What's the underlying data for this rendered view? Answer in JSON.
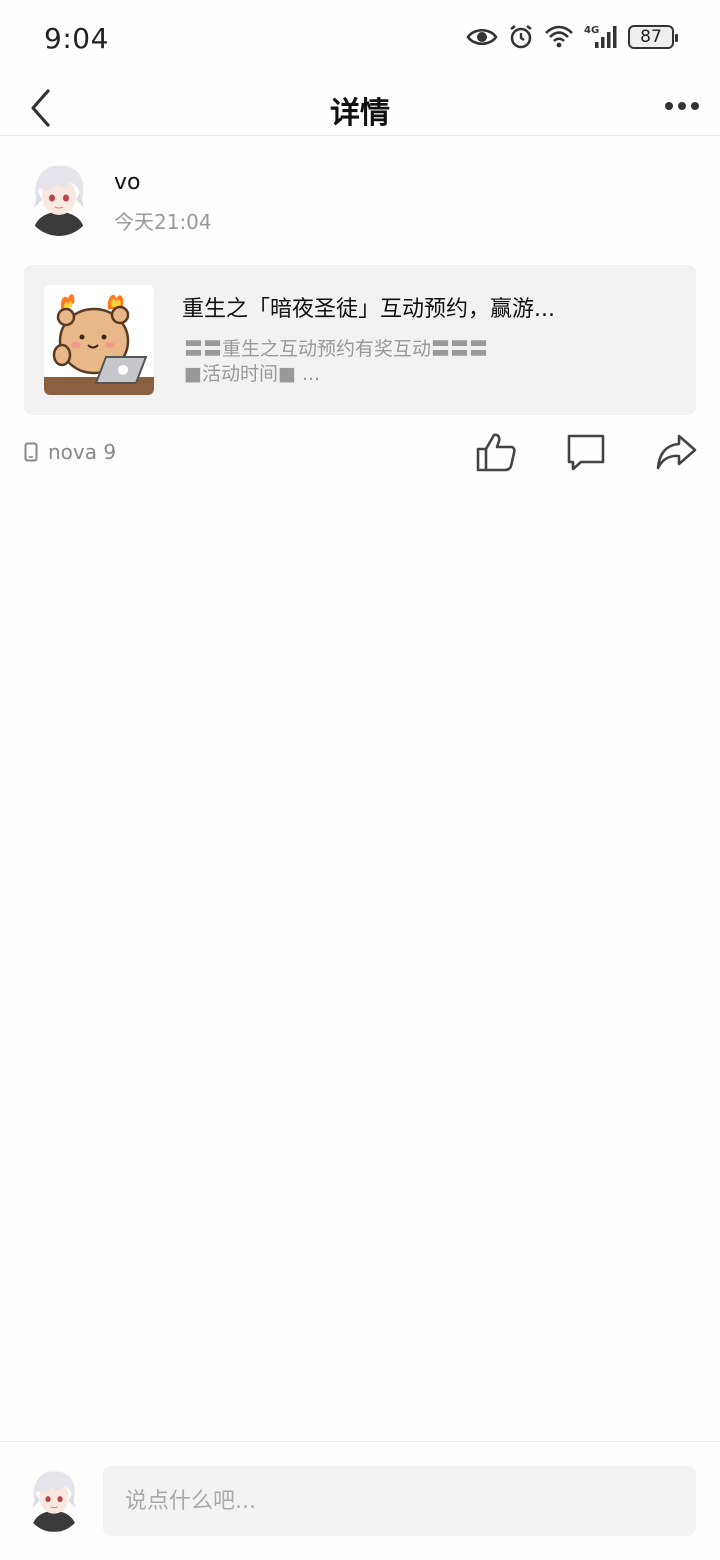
{
  "status_bar": {
    "time": "9:04",
    "battery": "87",
    "network": "4G",
    "icons": [
      "eye-icon",
      "alarm-icon",
      "wifi-icon",
      "signal-icon",
      "battery-icon"
    ]
  },
  "header": {
    "title": "详情",
    "back_icon": "back-arrow-icon",
    "more_icon": "more-dots-icon"
  },
  "post": {
    "author": "vo",
    "time": "今天21:04",
    "card": {
      "title": "重生之「暗夜圣徒」互动预约，赢游...",
      "desc_line1": "〓〓重生之互动预约有奖互动〓〓〓",
      "desc_line2": "■活动时间■ ...",
      "thumb_icon": "bear-laptop-sticker"
    },
    "device": "nova 9",
    "actions": [
      "thumbs-up-icon",
      "comment-icon",
      "share-icon"
    ]
  },
  "comment_bar": {
    "placeholder": "说点什么吧..."
  },
  "colors": {
    "background": "#fefefe",
    "card_bg": "#f2f2f2",
    "secondary_text": "#999999",
    "input_bg": "#f3f3f3"
  }
}
